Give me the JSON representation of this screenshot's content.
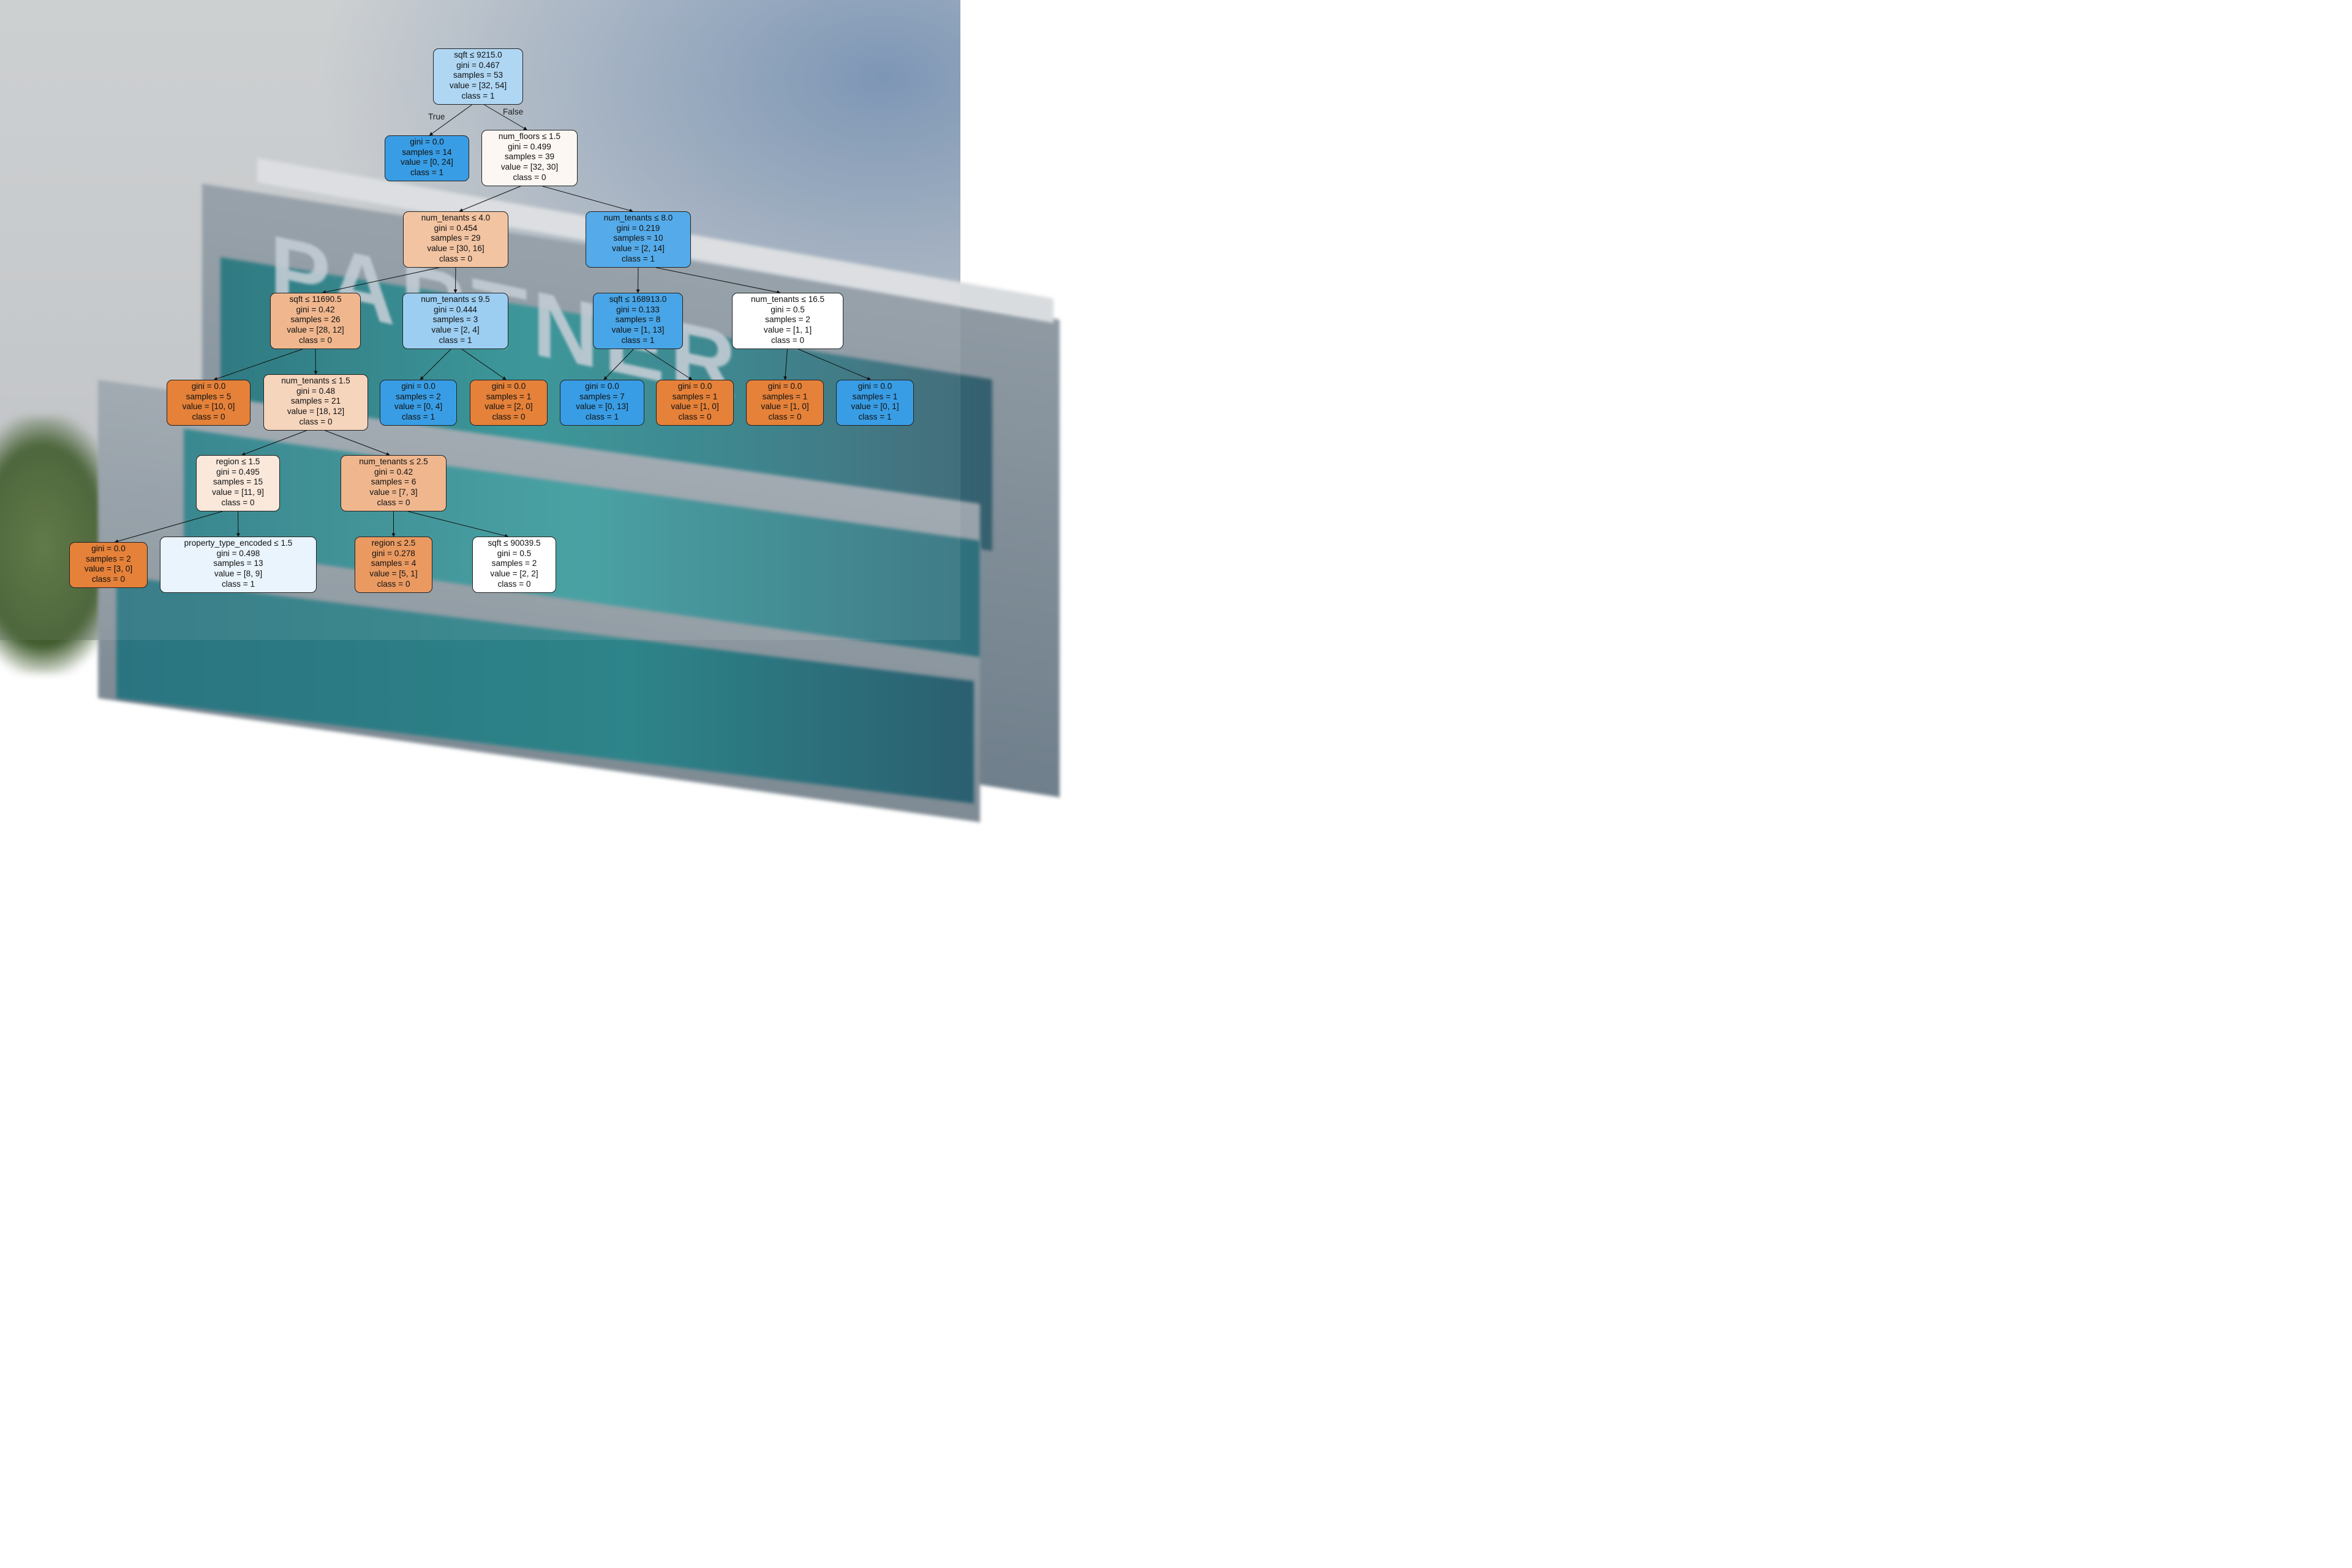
{
  "background_logo": "PARTNER",
  "edge_labels": {
    "true_label": "True",
    "false_label": "False"
  },
  "colors": {
    "class0_strong": "#e58139",
    "class1_strong": "#399de5",
    "neutral": "#ffffff"
  },
  "nodes": {
    "n0": {
      "lines": [
        "sqft ≤ 9215.0",
        "gini = 0.467",
        "samples = 53",
        "value = [32, 54]",
        "class = 1"
      ],
      "fill": "#afd7f4"
    },
    "n1": {
      "lines": [
        "gini = 0.0",
        "samples = 14",
        "value = [0, 24]",
        "class = 1"
      ],
      "fill": "#399de5"
    },
    "n2": {
      "lines": [
        "num_floors ≤ 1.5",
        "gini = 0.499",
        "samples = 39",
        "value = [32, 30]",
        "class = 0"
      ],
      "fill": "#fdf7f3"
    },
    "n3": {
      "lines": [
        "num_tenants ≤ 4.0",
        "gini = 0.454",
        "samples = 29",
        "value = [30, 16]",
        "class = 0"
      ],
      "fill": "#f3c4a2"
    },
    "n4": {
      "lines": [
        "num_tenants ≤ 8.0",
        "gini = 0.219",
        "samples = 10",
        "value = [2, 14]",
        "class = 1"
      ],
      "fill": "#55abe9"
    },
    "n5": {
      "lines": [
        "sqft ≤ 11690.5",
        "gini = 0.42",
        "samples = 26",
        "value = [28, 12]",
        "class = 0"
      ],
      "fill": "#f0b78e"
    },
    "n6": {
      "lines": [
        "num_tenants ≤ 9.5",
        "gini = 0.444",
        "samples = 3",
        "value = [2, 4]",
        "class = 1"
      ],
      "fill": "#9ccef2"
    },
    "n7": {
      "lines": [
        "sqft ≤ 168913.0",
        "gini = 0.133",
        "samples = 8",
        "value = [1, 13]",
        "class = 1"
      ],
      "fill": "#48a5e7"
    },
    "n8": {
      "lines": [
        "num_tenants ≤ 16.5",
        "gini = 0.5",
        "samples = 2",
        "value = [1, 1]",
        "class = 0"
      ],
      "fill": "#ffffff"
    },
    "n9": {
      "lines": [
        "gini = 0.0",
        "samples = 5",
        "value = [10, 0]",
        "class = 0"
      ],
      "fill": "#e58139"
    },
    "n10": {
      "lines": [
        "num_tenants ≤ 1.5",
        "gini = 0.48",
        "samples = 21",
        "value = [18, 12]",
        "class = 0"
      ],
      "fill": "#f6d5bd"
    },
    "n11": {
      "lines": [
        "gini = 0.0",
        "samples = 2",
        "value = [0, 4]",
        "class = 1"
      ],
      "fill": "#399de5"
    },
    "n12": {
      "lines": [
        "gini = 0.0",
        "samples = 1",
        "value = [2, 0]",
        "class = 0"
      ],
      "fill": "#e58139"
    },
    "n13": {
      "lines": [
        "gini = 0.0",
        "samples = 7",
        "value = [0, 13]",
        "class = 1"
      ],
      "fill": "#399de5"
    },
    "n14": {
      "lines": [
        "gini = 0.0",
        "samples = 1",
        "value = [1, 0]",
        "class = 0"
      ],
      "fill": "#e58139"
    },
    "n15": {
      "lines": [
        "gini = 0.0",
        "samples = 1",
        "value = [1, 0]",
        "class = 0"
      ],
      "fill": "#e58139"
    },
    "n16": {
      "lines": [
        "gini = 0.0",
        "samples = 1",
        "value = [0, 1]",
        "class = 1"
      ],
      "fill": "#399de5"
    },
    "n17": {
      "lines": [
        "region ≤ 1.5",
        "gini = 0.495",
        "samples = 15",
        "value = [11, 9]",
        "class = 0"
      ],
      "fill": "#fae8db"
    },
    "n18": {
      "lines": [
        "num_tenants ≤ 2.5",
        "gini = 0.42",
        "samples = 6",
        "value = [7, 3]",
        "class = 0"
      ],
      "fill": "#f0b78e"
    },
    "n19": {
      "lines": [
        "gini = 0.0",
        "samples = 2",
        "value = [3, 0]",
        "class = 0"
      ],
      "fill": "#e58139"
    },
    "n20": {
      "lines": [
        "property_type_encoded ≤ 1.5",
        "gini = 0.498",
        "samples = 13",
        "value = [8, 9]",
        "class = 1"
      ],
      "fill": "#e9f4fc"
    },
    "n21": {
      "lines": [
        "region ≤ 2.5",
        "gini = 0.278",
        "samples = 4",
        "value = [5, 1]",
        "class = 0"
      ],
      "fill": "#ea9a61"
    },
    "n22": {
      "lines": [
        "sqft ≤ 90039.5",
        "gini = 0.5",
        "samples = 2",
        "value = [2, 2]",
        "class = 0"
      ],
      "fill": "#ffffff"
    }
  }
}
